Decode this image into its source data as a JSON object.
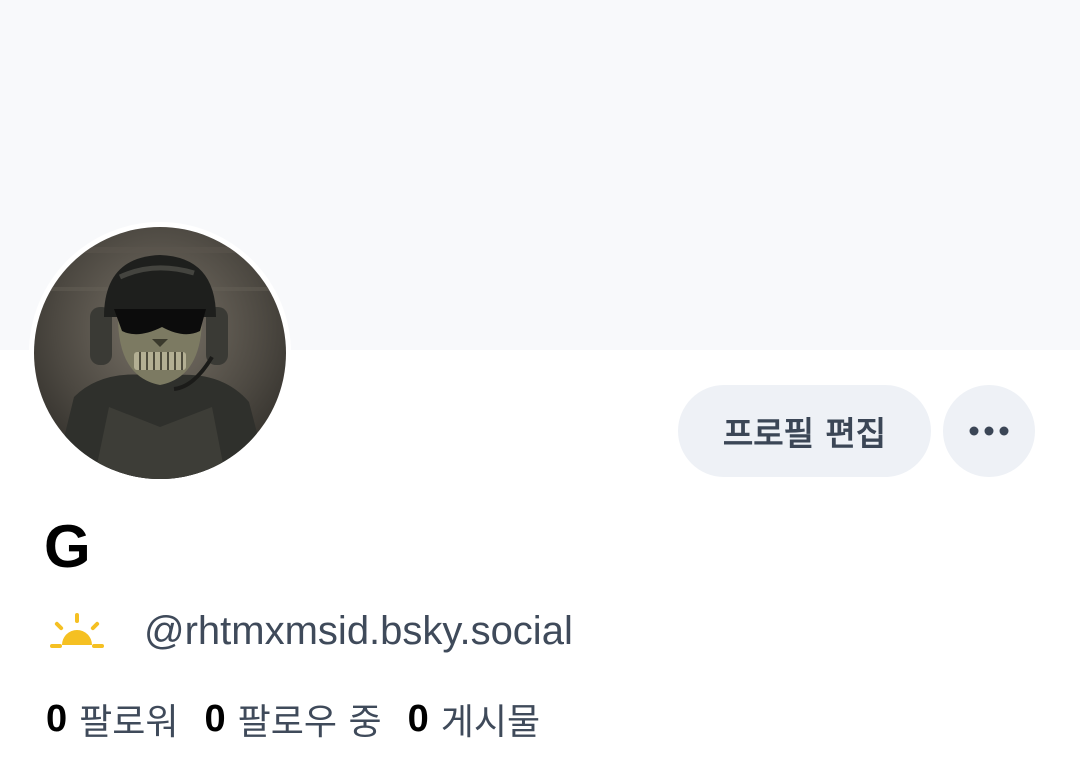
{
  "profile": {
    "edit_button_label": "프로필 편집",
    "display_name": "G",
    "handle": "@rhtmxmsid.bsky.social",
    "status_icon": "sunrise-icon",
    "stats": [
      {
        "count": "0",
        "label": "팔로워"
      },
      {
        "count": "0",
        "label": "팔로우 중"
      },
      {
        "count": "0",
        "label": "게시물"
      }
    ]
  },
  "colors": {
    "banner": "#f8f9fb",
    "button_bg": "#eef1f6",
    "button_text": "#3b4656",
    "secondary_text": "#3f4a5a",
    "sun_accent": "#f5c022"
  }
}
